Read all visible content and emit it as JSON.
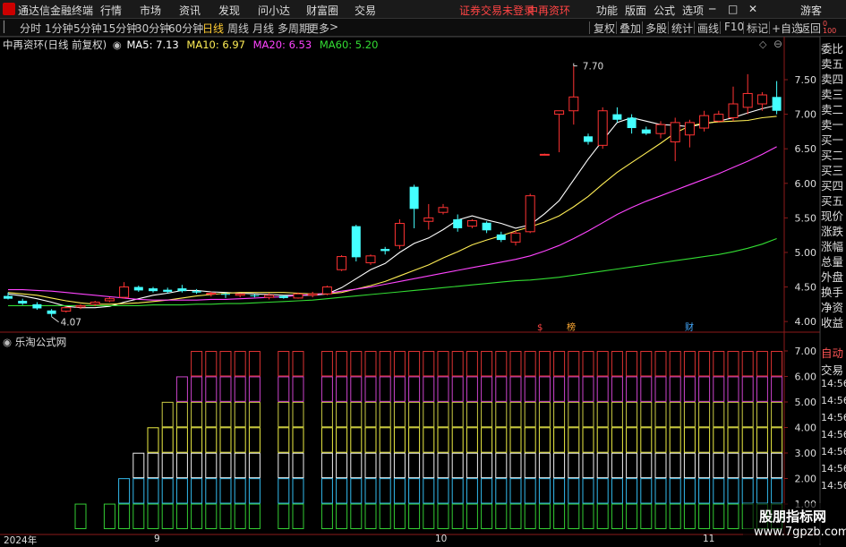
{
  "app": {
    "title": "通达信金融终端",
    "menu": [
      "行情",
      "市场",
      "资讯",
      "发现",
      "问小达",
      "财富圈",
      "交易"
    ],
    "login_notice": "证券交易未登录",
    "stock_name": "中再资环",
    "right_menu": [
      "功能",
      "版面",
      "公式",
      "选项"
    ],
    "guest": "游客"
  },
  "toolbar": {
    "periods": [
      "分时",
      "1分钟",
      "5分钟",
      "15分钟",
      "30分钟",
      "60分钟",
      "日线",
      "周线",
      "月线",
      "多周期",
      "更多"
    ],
    "selected_period": "日线",
    "more_arrow": ">",
    "buttons": [
      "复权",
      "叠加",
      "多股",
      "统计",
      "画线",
      "F10",
      "标记",
      "+自选",
      "返回"
    ]
  },
  "main_chart": {
    "title": "中再资环(日线 前复权)",
    "ma_labels": [
      {
        "text": "MA5: 7.13",
        "color": "#ffffff"
      },
      {
        "text": "MA10: 6.97",
        "color": "#ffee55"
      },
      {
        "text": "MA20: 6.53",
        "color": "#ff44ff"
      },
      {
        "text": "MA60: 5.20",
        "color": "#33dd33"
      }
    ],
    "high_label": "7.70",
    "low_label": "4.07",
    "events": [
      "$",
      "榜",
      "财"
    ],
    "top_right_mark": "0\n100"
  },
  "sub_chart": {
    "title": "乐淘公式网",
    "y_ticks": [
      "7.00",
      "6.00",
      "5.00",
      "4.00",
      "3.00",
      "2.00",
      "1.00"
    ]
  },
  "side_panel": {
    "items": [
      "委比",
      "卖五",
      "卖四",
      "卖三",
      "卖二",
      "卖一",
      "买一",
      "买二",
      "买三",
      "买四",
      "买五",
      "现价",
      "涨跌",
      "涨幅",
      "总量",
      "外盘",
      "换手",
      "净资",
      "收益"
    ],
    "lower": [
      "自动",
      "交易",
      "14:56",
      "14:56",
      "14:56",
      "14:56",
      "14:56",
      "14:56",
      "14:56"
    ]
  },
  "x_axis": {
    "labels": [
      "2024年",
      "9",
      "10",
      "11"
    ]
  },
  "watermark": {
    "text": "股朋指标网",
    "url": "www.7gpzb.com"
  },
  "chart_data": {
    "type": "candlestick",
    "y_ticks": [
      4.0,
      4.5,
      5.0,
      5.5,
      6.0,
      6.5,
      7.0,
      7.5
    ],
    "ylim": [
      3.95,
      7.85
    ],
    "candles": [
      {
        "o": 4.37,
        "h": 4.42,
        "l": 4.32,
        "c": 4.33
      },
      {
        "o": 4.3,
        "h": 4.33,
        "l": 4.24,
        "c": 4.26
      },
      {
        "o": 4.25,
        "h": 4.28,
        "l": 4.17,
        "c": 4.19
      },
      {
        "o": 4.16,
        "h": 4.18,
        "l": 4.07,
        "c": 4.11
      },
      {
        "o": 4.15,
        "h": 4.22,
        "l": 4.13,
        "c": 4.2
      },
      {
        "o": 4.21,
        "h": 4.25,
        "l": 4.18,
        "c": 4.23
      },
      {
        "o": 4.25,
        "h": 4.3,
        "l": 4.22,
        "c": 4.28
      },
      {
        "o": 4.3,
        "h": 4.35,
        "l": 4.28,
        "c": 4.33
      },
      {
        "o": 4.35,
        "h": 4.57,
        "l": 4.33,
        "c": 4.5
      },
      {
        "o": 4.5,
        "h": 4.52,
        "l": 4.43,
        "c": 4.45
      },
      {
        "o": 4.48,
        "h": 4.5,
        "l": 4.42,
        "c": 4.44
      },
      {
        "o": 4.46,
        "h": 4.49,
        "l": 4.41,
        "c": 4.43
      },
      {
        "o": 4.48,
        "h": 4.53,
        "l": 4.42,
        "c": 4.44
      },
      {
        "o": 4.44,
        "h": 4.47,
        "l": 4.4,
        "c": 4.42
      },
      {
        "o": 4.4,
        "h": 4.43,
        "l": 4.36,
        "c": 4.41
      },
      {
        "o": 4.4,
        "h": 4.42,
        "l": 4.34,
        "c": 4.39
      },
      {
        "o": 4.38,
        "h": 4.41,
        "l": 4.35,
        "c": 4.4
      },
      {
        "o": 4.38,
        "h": 4.4,
        "l": 4.35,
        "c": 4.37
      },
      {
        "o": 4.35,
        "h": 4.41,
        "l": 4.32,
        "c": 4.38
      },
      {
        "o": 4.37,
        "h": 4.38,
        "l": 4.33,
        "c": 4.34
      },
      {
        "o": 4.34,
        "h": 4.42,
        "l": 4.33,
        "c": 4.4
      },
      {
        "o": 4.38,
        "h": 4.43,
        "l": 4.35,
        "c": 4.4
      },
      {
        "o": 4.4,
        "h": 4.52,
        "l": 4.38,
        "c": 4.5
      },
      {
        "o": 4.75,
        "h": 4.96,
        "l": 4.73,
        "c": 4.94
      },
      {
        "o": 5.38,
        "h": 5.4,
        "l": 4.87,
        "c": 4.93
      },
      {
        "o": 4.85,
        "h": 4.97,
        "l": 4.82,
        "c": 4.95
      },
      {
        "o": 5.05,
        "h": 5.08,
        "l": 4.97,
        "c": 5.02
      },
      {
        "o": 5.1,
        "h": 5.48,
        "l": 5.05,
        "c": 5.42
      },
      {
        "o": 5.95,
        "h": 5.98,
        "l": 5.35,
        "c": 5.63
      },
      {
        "o": 5.45,
        "h": 5.7,
        "l": 5.33,
        "c": 5.5
      },
      {
        "o": 5.58,
        "h": 5.7,
        "l": 5.55,
        "c": 5.65
      },
      {
        "o": 5.48,
        "h": 5.55,
        "l": 5.3,
        "c": 5.35
      },
      {
        "o": 5.38,
        "h": 5.48,
        "l": 5.35,
        "c": 5.46
      },
      {
        "o": 5.43,
        "h": 5.45,
        "l": 5.28,
        "c": 5.32
      },
      {
        "o": 5.26,
        "h": 5.3,
        "l": 5.15,
        "c": 5.18
      },
      {
        "o": 5.15,
        "h": 5.32,
        "l": 5.1,
        "c": 5.28
      },
      {
        "o": 5.3,
        "h": 5.85,
        "l": 5.28,
        "c": 5.82
      },
      {
        "o": 6.42,
        "h": 6.43,
        "l": 6.41,
        "c": 6.42
      },
      {
        "o": 7.0,
        "h": 7.05,
        "l": 6.45,
        "c": 7.05
      },
      {
        "o": 7.05,
        "h": 7.7,
        "l": 6.85,
        "c": 7.25
      },
      {
        "o": 6.68,
        "h": 6.72,
        "l": 6.56,
        "c": 6.6
      },
      {
        "o": 6.55,
        "h": 7.1,
        "l": 6.5,
        "c": 7.05
      },
      {
        "o": 7.0,
        "h": 7.1,
        "l": 6.88,
        "c": 6.92
      },
      {
        "o": 6.95,
        "h": 7.0,
        "l": 6.72,
        "c": 6.8
      },
      {
        "o": 6.78,
        "h": 6.82,
        "l": 6.7,
        "c": 6.72
      },
      {
        "o": 6.72,
        "h": 6.9,
        "l": 6.65,
        "c": 6.85
      },
      {
        "o": 6.6,
        "h": 6.95,
        "l": 6.32,
        "c": 6.88
      },
      {
        "o": 6.7,
        "h": 6.92,
        "l": 6.52,
        "c": 6.88
      },
      {
        "o": 6.8,
        "h": 7.05,
        "l": 6.75,
        "c": 6.98
      },
      {
        "o": 6.9,
        "h": 7.05,
        "l": 6.88,
        "c": 7.0
      },
      {
        "o": 6.95,
        "h": 7.4,
        "l": 6.9,
        "c": 7.15
      },
      {
        "o": 7.1,
        "h": 7.58,
        "l": 7.0,
        "c": 7.3
      },
      {
        "o": 7.15,
        "h": 7.32,
        "l": 7.05,
        "c": 7.28
      },
      {
        "o": 7.25,
        "h": 7.48,
        "l": 7.0,
        "c": 7.05
      }
    ],
    "ma": {
      "MA5": [
        4.4,
        4.37,
        4.33,
        4.28,
        4.22,
        4.2,
        4.2,
        4.22,
        4.28,
        4.33,
        4.38,
        4.41,
        4.45,
        4.45,
        4.43,
        4.42,
        4.41,
        4.4,
        4.39,
        4.38,
        4.38,
        4.38,
        4.4,
        4.49,
        4.62,
        4.75,
        4.84,
        5.0,
        5.13,
        5.21,
        5.33,
        5.47,
        5.53,
        5.47,
        5.42,
        5.35,
        5.4,
        5.56,
        5.75,
        6.05,
        6.35,
        6.62,
        6.88,
        6.95,
        6.9,
        6.85,
        6.84,
        6.82,
        6.86,
        6.9,
        6.95,
        7.02,
        7.08,
        7.13
      ],
      "MA10": [
        4.42,
        4.4,
        4.38,
        4.34,
        4.3,
        4.27,
        4.25,
        4.25,
        4.26,
        4.27,
        4.29,
        4.31,
        4.34,
        4.37,
        4.39,
        4.41,
        4.42,
        4.42,
        4.42,
        4.42,
        4.41,
        4.4,
        4.4,
        4.42,
        4.47,
        4.52,
        4.58,
        4.66,
        4.74,
        4.82,
        4.92,
        5.01,
        5.11,
        5.18,
        5.24,
        5.31,
        5.37,
        5.44,
        5.53,
        5.66,
        5.81,
        5.99,
        6.16,
        6.3,
        6.44,
        6.58,
        6.73,
        6.83,
        6.87,
        6.89,
        6.9,
        6.91,
        6.95,
        6.97
      ],
      "MA20": [
        4.46,
        4.46,
        4.45,
        4.44,
        4.42,
        4.4,
        4.38,
        4.36,
        4.34,
        4.32,
        4.31,
        4.31,
        4.31,
        4.31,
        4.32,
        4.32,
        4.33,
        4.34,
        4.35,
        4.36,
        4.38,
        4.39,
        4.41,
        4.44,
        4.47,
        4.5,
        4.54,
        4.58,
        4.62,
        4.66,
        4.7,
        4.74,
        4.78,
        4.82,
        4.86,
        4.9,
        4.95,
        5.02,
        5.1,
        5.2,
        5.31,
        5.43,
        5.55,
        5.65,
        5.74,
        5.82,
        5.9,
        5.98,
        6.06,
        6.14,
        6.23,
        6.32,
        6.42,
        6.53
      ],
      "MA60": [
        4.23,
        4.23,
        4.23,
        4.23,
        4.23,
        4.23,
        4.23,
        4.23,
        4.23,
        4.23,
        4.24,
        4.24,
        4.24,
        4.25,
        4.25,
        4.26,
        4.26,
        4.27,
        4.28,
        4.29,
        4.3,
        4.31,
        4.33,
        4.35,
        4.37,
        4.39,
        4.41,
        4.43,
        4.45,
        4.47,
        4.49,
        4.51,
        4.53,
        4.55,
        4.57,
        4.59,
        4.6,
        4.62,
        4.64,
        4.67,
        4.7,
        4.73,
        4.76,
        4.79,
        4.82,
        4.85,
        4.88,
        4.91,
        4.94,
        4.97,
        5.01,
        5.06,
        5.12,
        5.2
      ]
    },
    "sub_levels": [
      0,
      0,
      0,
      0,
      0,
      1,
      0,
      1,
      2,
      3,
      4,
      5,
      6,
      7,
      7,
      7,
      7,
      7,
      0,
      7,
      7,
      0,
      7,
      7,
      7,
      7,
      7,
      7,
      7,
      7,
      7,
      7,
      7,
      7,
      7,
      7,
      7,
      7,
      7,
      7,
      7,
      7,
      7,
      7,
      7,
      7,
      7,
      7,
      7,
      7,
      7,
      7,
      7,
      7
    ]
  }
}
